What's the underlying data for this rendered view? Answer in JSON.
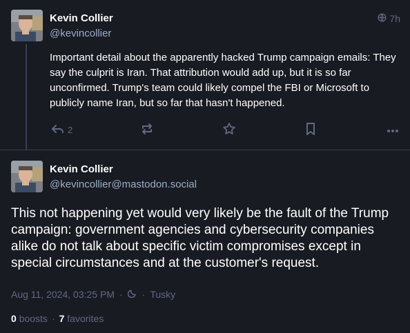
{
  "parent_post": {
    "author_name": "Kevin Collier",
    "author_handle": "@kevincollier",
    "visibility_icon": "globe-icon",
    "time": "7h",
    "text": "Important detail about the apparently hacked Trump campaign emails: They say the culprit is Iran. That attribution would add up, but it is so far unconfirmed. Trump's team could likely compel the FBI or Microsoft to publicly name Iran, but so far that hasn't happened.",
    "reply_count": "2",
    "actions": [
      "reply-icon",
      "boost-icon",
      "favorite-icon",
      "bookmark-icon",
      "more-icon"
    ]
  },
  "detail_post": {
    "author_name": "Kevin Collier",
    "author_handle": "@kevincollier@mastodon.social",
    "text": "This not happening yet would very likely be the fault of the Trump campaign: government agencies and cybersecurity companies alike do not talk about specific victim compromises except in special circumstances and at the customer's request.",
    "date": "Aug 11, 2024, 03:25 PM",
    "separator": "·",
    "visibility_icon": "moon-icon",
    "application": "Tusky",
    "boosts_count": "0",
    "boosts_label": "boosts",
    "favorites_count": "7",
    "favorites_label": "favorites"
  },
  "colors": {
    "background": "#191b22",
    "border": "#393f4f",
    "muted": "#606984",
    "handle": "#9baec8",
    "text": "#ffffff"
  }
}
